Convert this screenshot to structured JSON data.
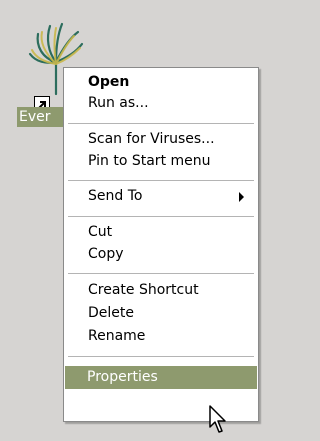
{
  "desktop": {
    "icon_label": "Ever",
    "colors": {
      "selection": "#8e9a6e",
      "background": "#d6d4d2"
    }
  },
  "context_menu": {
    "items": [
      {
        "label": "Open",
        "bold": true
      },
      {
        "label": "Run as..."
      },
      {
        "label": "Scan for Viruses..."
      },
      {
        "label": "Pin to Start menu"
      },
      {
        "label": "Send To",
        "submenu": true
      },
      {
        "label": "Cut"
      },
      {
        "label": "Copy"
      },
      {
        "label": "Create Shortcut"
      },
      {
        "label": "Delete"
      },
      {
        "label": "Rename"
      },
      {
        "label": "Properties",
        "selected": true
      }
    ]
  }
}
